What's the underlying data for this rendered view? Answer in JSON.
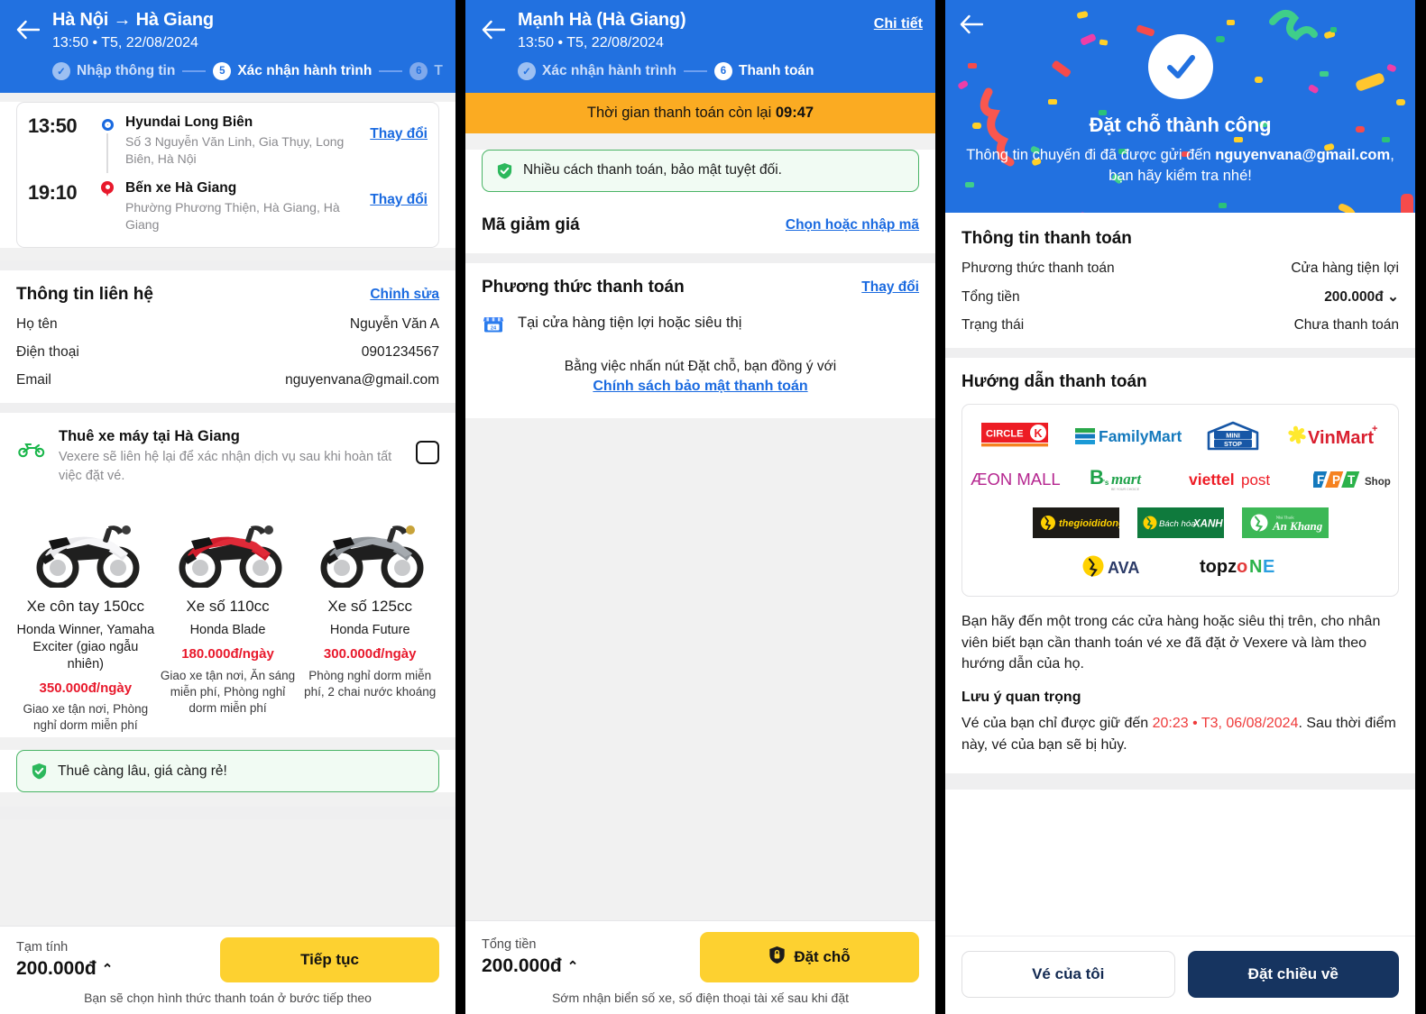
{
  "panel1": {
    "header": {
      "title": "Hà Nội → Hà Giang",
      "subtitle": "13:50 • T5, 22/08/2024",
      "steps": [
        {
          "badge": "✓",
          "label": "Nhập thông tin",
          "state": "done"
        },
        {
          "badge": "5",
          "label": "Xác nhận hành trình",
          "state": "cur"
        },
        {
          "badge": "6",
          "label": "Thanh",
          "state": "next"
        }
      ]
    },
    "route": {
      "pickup": {
        "time": "13:50",
        "name": "Hyundai Long Biên",
        "address": "Số 3 Nguyễn Văn Linh, Gia Thụy, Long Biên, Hà Nội",
        "change_label": "Thay đổi"
      },
      "dropoff": {
        "time": "19:10",
        "name": "Bến xe Hà Giang",
        "address": "Phường Phương Thiện, Hà Giang, Hà Giang",
        "change_label": "Thay đổi"
      }
    },
    "contact": {
      "title": "Thông tin liên hệ",
      "edit_label": "Chỉnh sửa",
      "rows": [
        {
          "key": "Họ tên",
          "value": "Nguyễn Văn A"
        },
        {
          "key": "Điện thoại",
          "value": "0901234567"
        },
        {
          "key": "Email",
          "value": "nguyenvana@gmail.com"
        }
      ]
    },
    "bike_rental": {
      "title": "Thuê xe máy tại Hà Giang",
      "desc": "Vexere sẽ liên hệ lại để xác nhận dịch vụ sau khi hoàn tất việc đặt vé.",
      "checked": false,
      "options": [
        {
          "name": "Xe côn tay 150cc",
          "model": "Honda Winner, Yamaha Exciter (giao ngẫu nhiên)",
          "price": "350.000đ/ngày",
          "perks": "Giao xe tận nơi, Phòng nghỉ dorm miễn phí"
        },
        {
          "name": "Xe số 110cc",
          "model": "Honda Blade",
          "price": "180.000đ/ngày",
          "perks": "Giao xe tận nơi, Ăn sáng miễn phí, Phòng nghỉ dorm miễn phí"
        },
        {
          "name": "Xe số 125cc",
          "model": "Honda Future",
          "price": "300.000đ/ngày",
          "perks": "Phòng nghỉ dorm miễn phí, 2 chai nước khoáng"
        }
      ],
      "notice": "Thuê càng lâu, giá càng rẻ!"
    },
    "bottom": {
      "label": "Tạm tính",
      "amount": "200.000đ",
      "caret": "⌃",
      "cta": "Tiếp tục",
      "footnote": "Bạn sẽ chọn hình thức thanh toán ở bước tiếp theo"
    }
  },
  "panel2": {
    "header": {
      "title": "Mạnh Hà (Hà Giang)",
      "subtitle": "13:50 • T5, 22/08/2024",
      "detail_link": "Chi tiết",
      "steps": [
        {
          "badge": "✓",
          "label": "Xác nhận hành trình",
          "state": "done"
        },
        {
          "badge": "6",
          "label": "Thanh toán",
          "state": "cur"
        }
      ]
    },
    "timer": {
      "prefix": "Thời gian thanh toán còn lại ",
      "value": "09:47"
    },
    "notice": "Nhiều cách thanh toán, bảo mật tuyệt đối.",
    "promo": {
      "title": "Mã giảm giá",
      "link": "Chọn hoặc nhập mã"
    },
    "payment": {
      "title": "Phương thức thanh toán",
      "change_link": "Thay đổi",
      "selected_method": "Tại cửa hàng tiện lợi hoặc siêu thị",
      "agree_text": "Bằng việc nhấn nút Đặt chỗ, bạn đồng ý với",
      "policy_link": "Chính sách bảo mật thanh toán"
    },
    "bottom": {
      "label": "Tổng tiền",
      "amount": "200.000đ",
      "caret": "⌃",
      "cta": "Đặt chỗ",
      "footnote": "Sớm nhận biển số xe, số điện thoại tài xế sau khi đặt"
    }
  },
  "panel3": {
    "success": {
      "title": "Đặt chỗ thành công",
      "desc_prefix": "Thông tin chuyến đi đã được gửi đến ",
      "email": "nguyenvana@gmail.com",
      "desc_suffix": ", bạn hãy kiểm tra nhé!"
    },
    "payment_info": {
      "title": "Thông tin thanh toán",
      "rows": [
        {
          "key": "Phương thức thanh toán",
          "value": "Cửa hàng tiện lợi",
          "style": "plain"
        },
        {
          "key": "Tổng tiền",
          "value": "200.000đ",
          "style": "bold",
          "caret": "⌄"
        },
        {
          "key": "Trạng thái",
          "value": "Chưa thanh toán",
          "style": "red"
        }
      ]
    },
    "guide": {
      "title": "Hướng dẫn thanh toán",
      "stores": [
        [
          "CIRCLE K",
          "FamilyMart",
          "MINI STOP",
          "VinMart"
        ],
        [
          "ÆON MALL",
          "B'smart",
          "viettel post",
          "FPT Shop"
        ],
        [
          "thegioididong",
          "Bách hóa XANH",
          "An Khang"
        ],
        [
          "AVA",
          "topzone"
        ]
      ],
      "instruction": "Bạn hãy đến một trong các cửa hàng hoặc siêu thị trên, cho nhân viên biết bạn cần thanh toán vé xe đã đặt ở Vexere và làm theo hướng dẫn của họ.",
      "note_title": "Lưu ý quan trọng",
      "note_prefix": "Vé của bạn chỉ được giữ đến ",
      "note_deadline": "20:23 • T3, 06/08/2024",
      "note_suffix": ". Sau thời điểm này, vé của bạn sẽ bị hủy."
    },
    "bottom": {
      "secondary_cta": "Vé của tôi",
      "primary_cta": "Đặt chiều về"
    }
  },
  "colors": {
    "brand_blue": "#2271e0",
    "yellow": "#fdd130",
    "orange": "#fbab22",
    "red": "#e8192c",
    "green": "#49b465",
    "navy": "#163460"
  }
}
